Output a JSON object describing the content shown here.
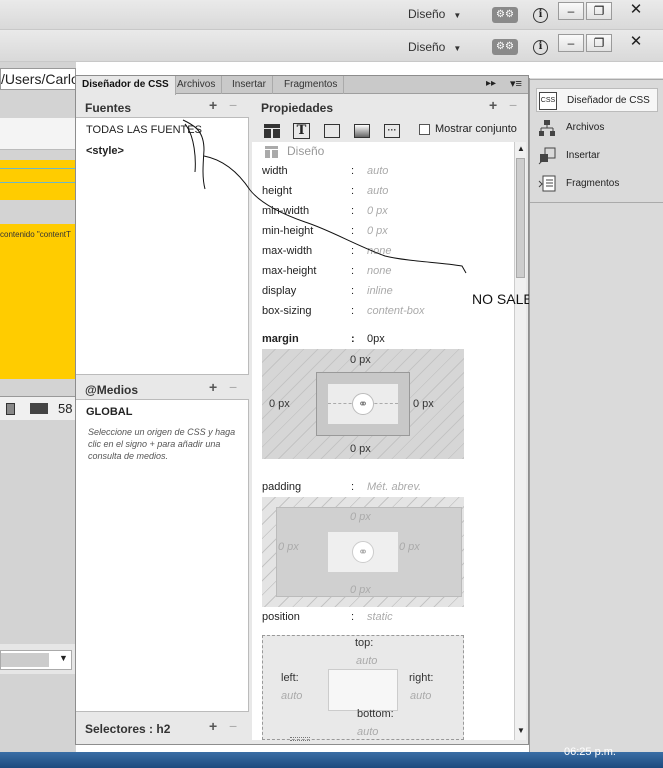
{
  "top_bars": [
    {
      "design_label": "Diseño"
    },
    {
      "design_label": "Diseño"
    }
  ],
  "window_buttons": {
    "minimize": "–",
    "restore": "❐",
    "close": "✕"
  },
  "left_doc": {
    "path_text": "/Users/Carlo",
    "content_text": "contenido \"contentT",
    "number": "58"
  },
  "tabs": [
    "Diseñador de CSS",
    "Archivos",
    "Insertar",
    "Fragmentos"
  ],
  "fuentes": {
    "title": "Fuentes",
    "items": [
      "TODAS LAS FUENTES",
      "<style>"
    ]
  },
  "medios": {
    "title": "@Medios",
    "global": "GLOBAL",
    "help": "Seleccione un origen de CSS y haga clic en el signo + para añadir una consulta de medios."
  },
  "selectores": {
    "title": "Selectores : h2"
  },
  "propiedades": {
    "title": "Propiedades",
    "mostrar_conjunto": "Mostrar conjunto",
    "section": "Diseño",
    "rows": [
      {
        "name": "width",
        "value": "auto"
      },
      {
        "name": "height",
        "value": "auto"
      },
      {
        "name": "min-width",
        "value": "0 px"
      },
      {
        "name": "min-height",
        "value": "0 px"
      },
      {
        "name": "max-width",
        "value": "none"
      },
      {
        "name": "max-height",
        "value": "none"
      },
      {
        "name": "display",
        "value": "inline"
      },
      {
        "name": "box-sizing",
        "value": "content-box"
      }
    ],
    "margin": {
      "label": "margin",
      "value": "0px",
      "top": "0 px",
      "right": "0 px",
      "bottom": "0 px",
      "left": "0 px"
    },
    "padding": {
      "label": "padding",
      "value": "Mét. abrev.",
      "top": "0 px",
      "right": "0 px",
      "bottom": "0 px",
      "left": "0 px"
    },
    "position": {
      "label": "position",
      "value": "static",
      "top_label": "top:",
      "top_val": "auto",
      "left_label": "left:",
      "left_val": "auto",
      "right_label": "right:",
      "right_val": "auto",
      "bottom_label": "bottom:",
      "bottom_val": "auto"
    }
  },
  "annotation": "NO SALEN REGLAS CSS",
  "sidebar": {
    "items": [
      "Diseñador de CSS",
      "Archivos",
      "Insertar",
      "Fragmentos"
    ]
  },
  "taskbar": {
    "clock": "06:25 p.m."
  }
}
